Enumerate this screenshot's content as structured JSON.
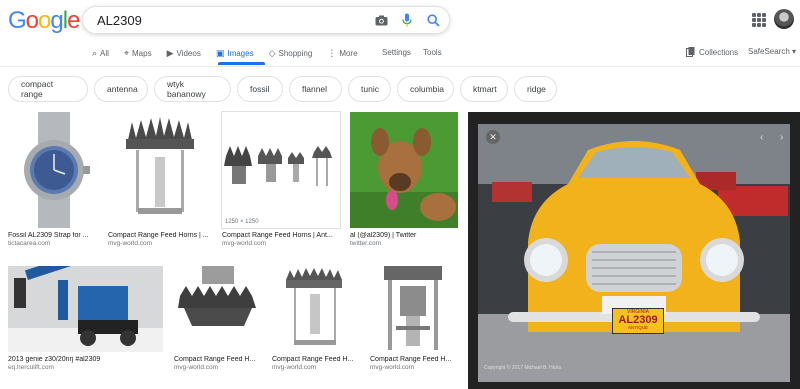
{
  "header": {
    "logo": [
      "G",
      "o",
      "o",
      "g",
      "l",
      "e"
    ],
    "logo_colors": [
      "#4285f4",
      "#ea4335",
      "#fbbc05",
      "#4285f4",
      "#34a853",
      "#ea4335"
    ],
    "query": "AL2309"
  },
  "tabs": [
    {
      "label": "All",
      "icon": "search-icon"
    },
    {
      "label": "Maps",
      "icon": "map-pin-icon"
    },
    {
      "label": "Videos",
      "icon": "video-icon"
    },
    {
      "label": "Images",
      "icon": "image-icon"
    },
    {
      "label": "Shopping",
      "icon": "tag-icon"
    },
    {
      "label": "More",
      "icon": "more-dots-icon"
    }
  ],
  "toolbar": {
    "settings": "Settings",
    "tools": "Tools",
    "collections": "Collections",
    "safesearch": "SafeSearch"
  },
  "chips": [
    "compact range",
    "antenna",
    "wtyk bananowy",
    "fossil",
    "flannel",
    "tunic",
    "columbia",
    "ktmart",
    "ridge"
  ],
  "results": [
    {
      "title": "Fossil AL2309 Strap for ...",
      "source": "tictacarea.com"
    },
    {
      "title": "Compact Range Feed Horns | ...",
      "source": "mvg-world.com"
    },
    {
      "title": "Compact Range Feed Horns | Ant...",
      "source": "mvg-world.com",
      "dims": "1250 × 1250"
    },
    {
      "title": "al (@al2309) | Twitter",
      "source": "twitter.com"
    },
    {
      "title": "2013 genie z30/20nrj #al2309",
      "source": "eq.herculift.com"
    },
    {
      "title": "Compact Range Feed H...",
      "source": "mvg-world.com"
    },
    {
      "title": "Compact Range Feed H...",
      "source": "mvg-world.com"
    },
    {
      "title": "Compact Range Feed H...",
      "source": "mvg-world.com"
    }
  ],
  "preview": {
    "plate_top": "VIRGINIA",
    "plate_main": "AL2309",
    "plate_bottom": "ANTIQUE",
    "credit": "Copyright © 2017 Michael B. Hicks"
  },
  "colors": {
    "accent": "#1a73e8",
    "car_yellow": "#f2b21b"
  }
}
